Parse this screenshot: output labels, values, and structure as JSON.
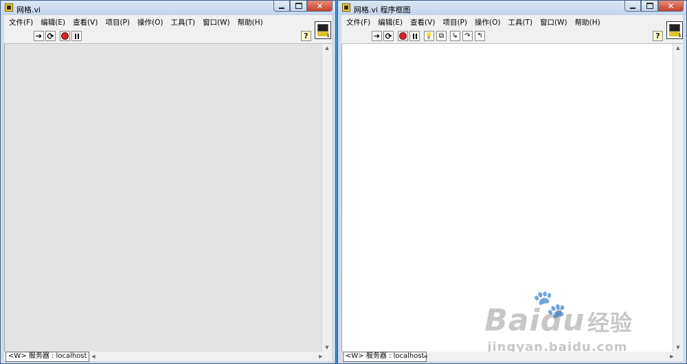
{
  "front_panel": {
    "title": "网格.vi",
    "menu": [
      "文件(F)",
      "编辑(E)",
      "查看(V)",
      "项目(P)",
      "操作(O)",
      "工具(T)",
      "窗口(W)",
      "帮助(H)"
    ],
    "status": "<W> 服务器 : localhost",
    "icon_number": "1"
  },
  "block_diagram": {
    "title": "网格.vi 程序框图",
    "menu": [
      "文件(F)",
      "编辑(E)",
      "查看(V)",
      "项目(P)",
      "操作(O)",
      "工具(T)",
      "窗口(W)",
      "帮助(H)"
    ],
    "status": "<W> 服务器 : localhost",
    "icon_number": "1"
  },
  "glyphs": {
    "close": "✕",
    "arrow_up": "▲",
    "arrow_down": "▼",
    "arrow_left": "◀",
    "arrow_right": "▶"
  },
  "watermark": {
    "logo": "Bai",
    "logo2": "du",
    "cn": "经验",
    "url": "jingyan.baidu.com"
  },
  "colors": {
    "front_panel_bg": "#e3e3e3",
    "block_diagram_bg": "#ffffff",
    "close_button": "#c4412a"
  }
}
